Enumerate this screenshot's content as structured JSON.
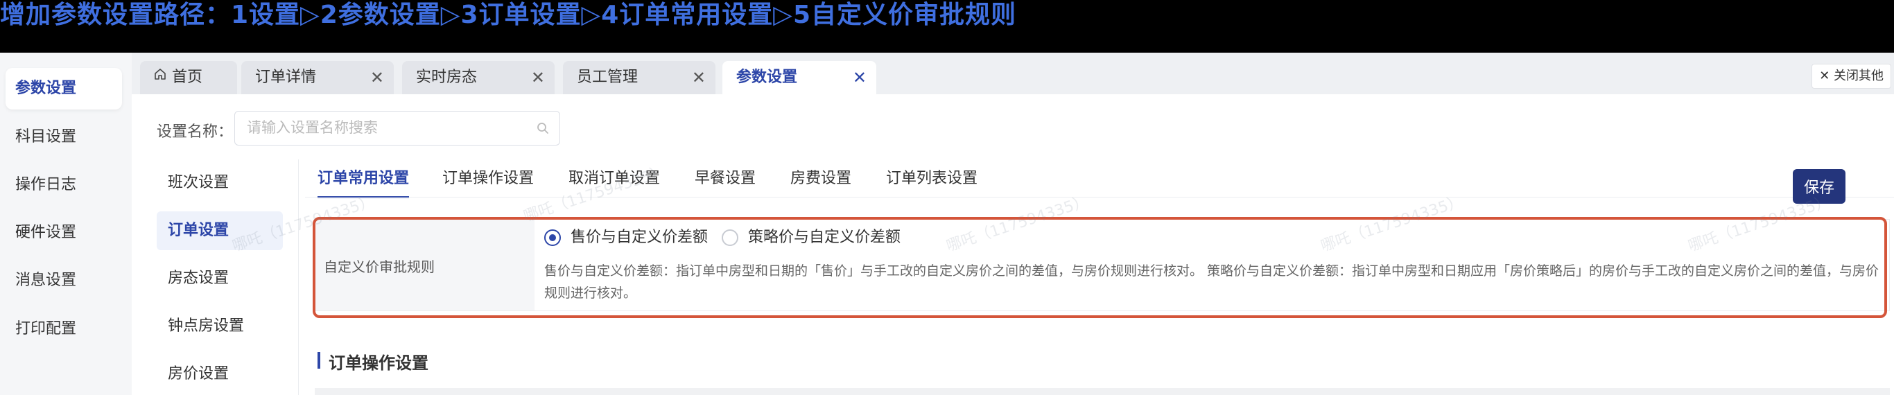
{
  "banner": {
    "text": "增加参数设置路径：1设置▷2参数设置▷3订单设置▷4订单常用设置▷5自定义价审批规则"
  },
  "sidebar": {
    "items": [
      {
        "label": "参数设置",
        "active": true
      },
      {
        "label": "科目设置"
      },
      {
        "label": "操作日志"
      },
      {
        "label": "硬件设置"
      },
      {
        "label": "消息设置"
      },
      {
        "label": "打印配置"
      }
    ]
  },
  "tabs": {
    "items": [
      {
        "label": "首页",
        "icon": "home-icon",
        "closable": false
      },
      {
        "label": "订单详情",
        "closable": true
      },
      {
        "label": "实时房态",
        "closable": true
      },
      {
        "label": "员工管理",
        "closable": true
      },
      {
        "label": "参数设置",
        "closable": true,
        "active": true
      }
    ],
    "close_glyph": "✕",
    "close_others": "✕ 关闭其他"
  },
  "search": {
    "label": "设置名称：",
    "placeholder": "请输入设置名称搜索",
    "value": ""
  },
  "subnav": {
    "items": [
      {
        "label": "班次设置"
      },
      {
        "label": "订单设置",
        "active": true
      },
      {
        "label": "房态设置"
      },
      {
        "label": "钟点房设置"
      },
      {
        "label": "房价设置"
      }
    ]
  },
  "settings_tabs": {
    "items": [
      {
        "label": "订单常用设置",
        "active": true
      },
      {
        "label": "订单操作设置"
      },
      {
        "label": "取消订单设置"
      },
      {
        "label": "早餐设置"
      },
      {
        "label": "房费设置"
      },
      {
        "label": "订单列表设置"
      }
    ]
  },
  "toolbar": {
    "save_label": "保存"
  },
  "rule": {
    "label": "自定义价审批规则",
    "options": [
      {
        "label": "售价与自定义价差额",
        "checked": true
      },
      {
        "label": "策略价与自定义价差额",
        "checked": false
      }
    ],
    "description": "售价与自定义价差额：指订单中房型和日期的「售价」与手工改的自定义房价之间的差值，与房价规则进行核对。 策略价与自定义价差额：指订单中房型和日期应用「房价策略后」的房价与手工改的自定义房价之间的差值，与房价规则进行核对。"
  },
  "section": {
    "title": "订单操作设置"
  },
  "watermark": {
    "text": "哪吒（117594335）"
  },
  "colors": {
    "accent": "#2d46a8",
    "save_button": "#24357c",
    "highlight_border": "#d4553a",
    "banner_text": "#3f6fe0",
    "banner_bg": "#000000"
  }
}
